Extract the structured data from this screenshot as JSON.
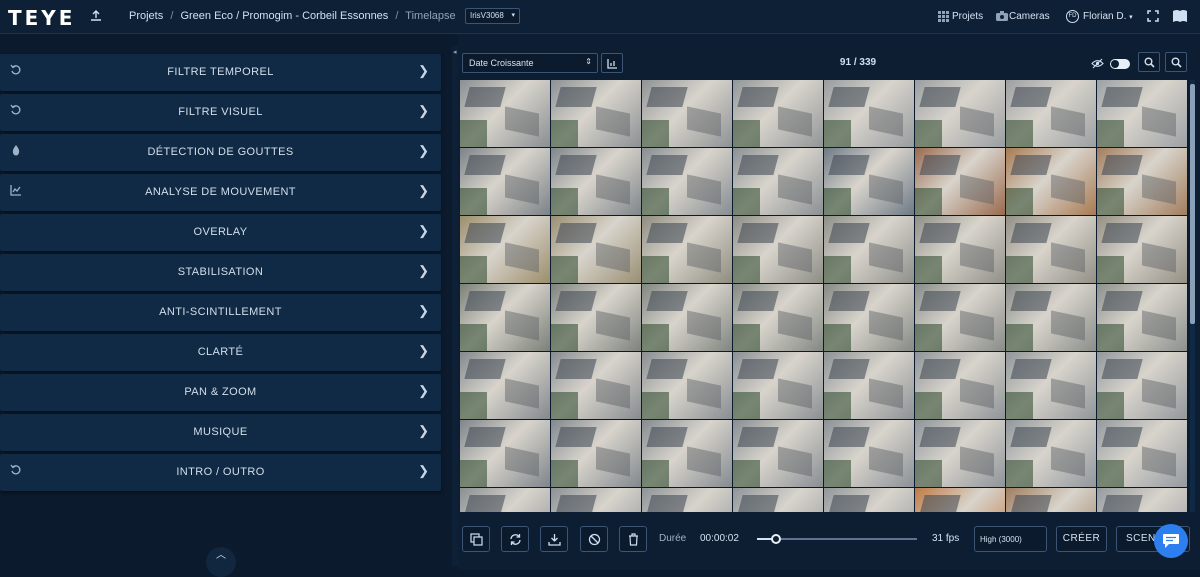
{
  "app": {
    "logo": "TEYE"
  },
  "breadcrumb": {
    "items": [
      "Projets",
      "Green Eco / Promogim - Corbeil Essonnes"
    ],
    "current": "Timelapse",
    "separator": "/"
  },
  "camera_select": {
    "value": "IrisV3068"
  },
  "top_nav": {
    "projects": "Projets",
    "cameras": "Cameras",
    "user_initials": "FD",
    "user": "Florian D."
  },
  "filters": [
    {
      "label": "FILTRE TEMPOREL",
      "icon": "undo-icon"
    },
    {
      "label": "FILTRE VISUEL",
      "icon": "undo-icon"
    },
    {
      "label": "DÉTECTION DE GOUTTES",
      "icon": "drop-icon"
    },
    {
      "label": "ANALYSE DE MOUVEMENT",
      "icon": "chart-line-icon"
    },
    {
      "label": "OVERLAY",
      "icon": ""
    },
    {
      "label": "STABILISATION",
      "icon": ""
    },
    {
      "label": "ANTI-SCINTILLEMENT",
      "icon": ""
    },
    {
      "label": "CLARTÉ",
      "icon": ""
    },
    {
      "label": "PAN & ZOOM",
      "icon": ""
    },
    {
      "label": "MUSIQUE",
      "icon": ""
    },
    {
      "label": "INTRO / OUTRO",
      "icon": "undo-icon"
    }
  ],
  "toolbar": {
    "sort_value": "Date Croissante",
    "counter": "91 / 339",
    "selected": 91,
    "total": 339,
    "toggle_on": false
  },
  "grid": {
    "columns": 8,
    "rows": 7,
    "tints": [
      [
        "#8a8f92",
        "#8c9194",
        "#8f9295",
        "#929698",
        "#989ca0",
        "#9a9ea2",
        "#9ca0a3",
        "#9da1a5"
      ],
      [
        "#7c8287",
        "#80868b",
        "#878d92",
        "#8b9094",
        "#6e7a86",
        "#9a6a4e",
        "#a87a52",
        "#a27d5c"
      ],
      [
        "#9c8e6c",
        "#9a8f74",
        "#8f8c80",
        "#8d8d86",
        "#8e8f8a",
        "#908f88",
        "#928f86",
        "#958f84"
      ],
      [
        "#7a8078",
        "#7d837d",
        "#808680",
        "#838883",
        "#868a85",
        "#888c88",
        "#8a8e8a",
        "#8c908c"
      ],
      [
        "#84898d",
        "#878c90",
        "#898e92",
        "#8b9094",
        "#8d9296",
        "#8f9498",
        "#91969a",
        "#93989c"
      ],
      [
        "#7f858b",
        "#82888e",
        "#858b91",
        "#888e94",
        "#8b9197",
        "#8e949a",
        "#91979d",
        "#949aa0"
      ],
      [
        "#8a8f94",
        "#8c9196",
        "#8e9398",
        "#90959a",
        "#92979c",
        "#c07a45",
        "#a07e60",
        "#969aa0"
      ]
    ]
  },
  "bottom": {
    "duration_label": "Durée",
    "duration_value": "00:00:02",
    "progress": 0.12,
    "fps": "31 fps",
    "quality": "High (3000)",
    "create": "CRÉER",
    "scenes": "SCENES"
  },
  "colors": {
    "background": "#0b1a2c",
    "panel": "#102944",
    "accent": "#2d7ff0"
  }
}
